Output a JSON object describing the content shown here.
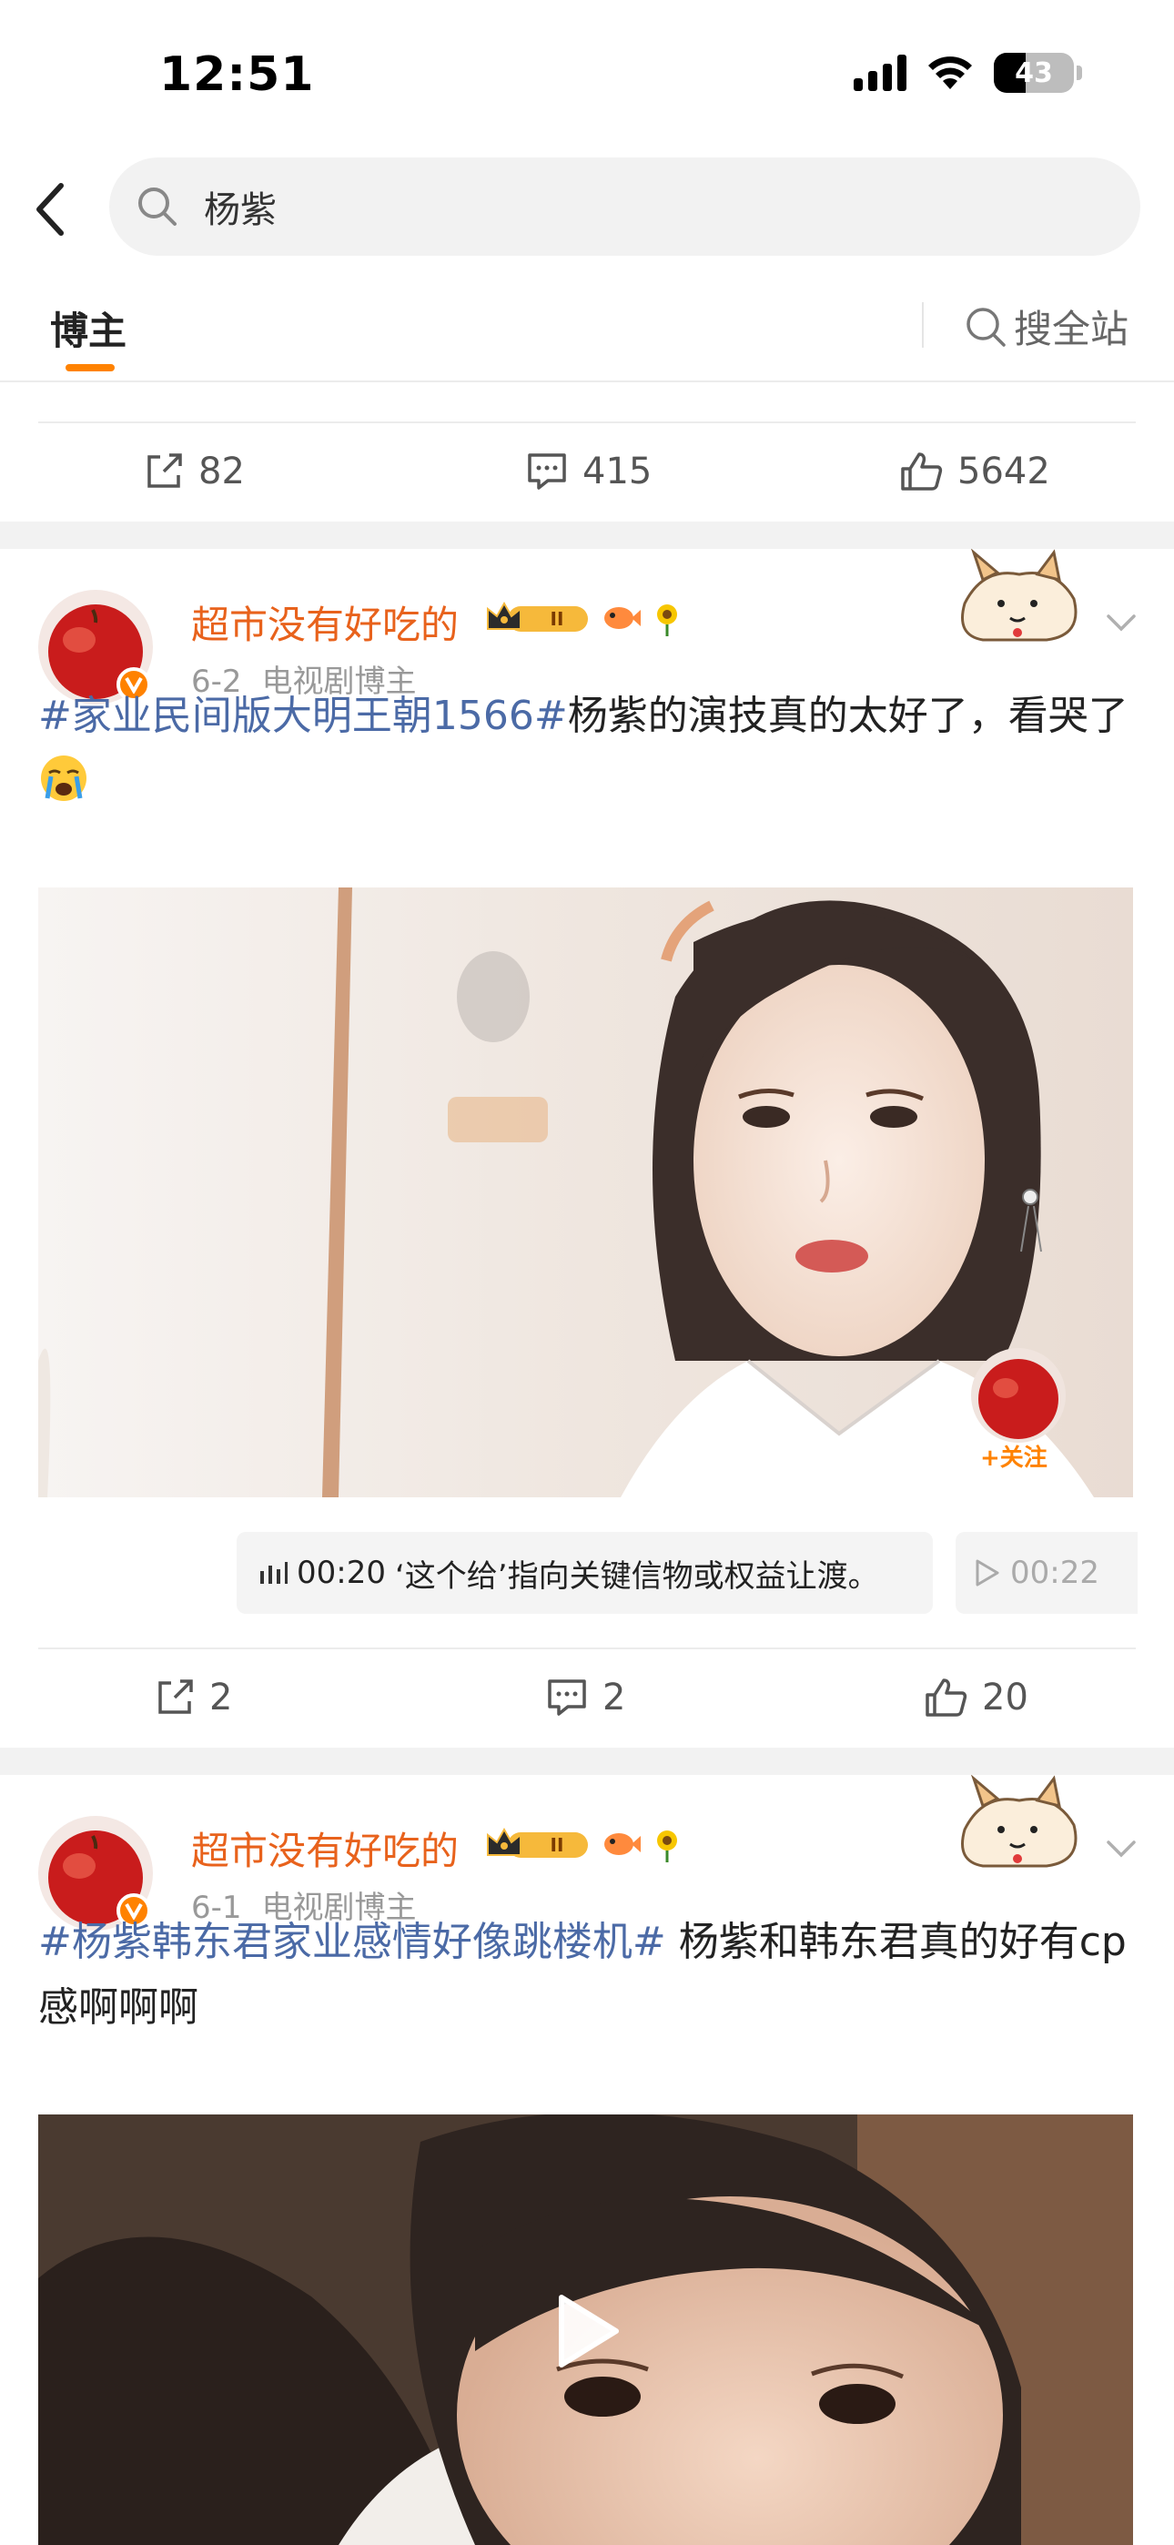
{
  "status_bar": {
    "time": "12:51",
    "battery": "43"
  },
  "search": {
    "query": "杨紫"
  },
  "tabs": {
    "active": "博主",
    "site_search": "搜全站"
  },
  "top_actions": {
    "reposts": "82",
    "comments": "415",
    "likes": "5642"
  },
  "posts": [
    {
      "username": "超市没有好吃的",
      "level_badge": "II",
      "date": "6-2",
      "source": "电视剧博主",
      "hashtag": "#家业民间版大明王朝1566#",
      "text": "杨紫的演技真的太好了，看哭了",
      "subtitle_time": "00:20",
      "subtitle_text": "‘这个给’指向关键信物或权益让渡。",
      "next_subtitle_time": "00:22",
      "follow_label": "+关注",
      "reposts": "2",
      "comments": "2",
      "likes": "20"
    },
    {
      "username": "超市没有好吃的",
      "level_badge": "II",
      "date": "6-1",
      "source": "电视剧博主",
      "hashtag": "#杨紫韩东君家业感情好像跳楼机#",
      "text": " 杨紫和韩东君真的好有cp感啊啊啊"
    }
  ],
  "colors": {
    "accent": "#ff8200",
    "username": "#e8621c",
    "hashtag": "#4b6aa6"
  }
}
